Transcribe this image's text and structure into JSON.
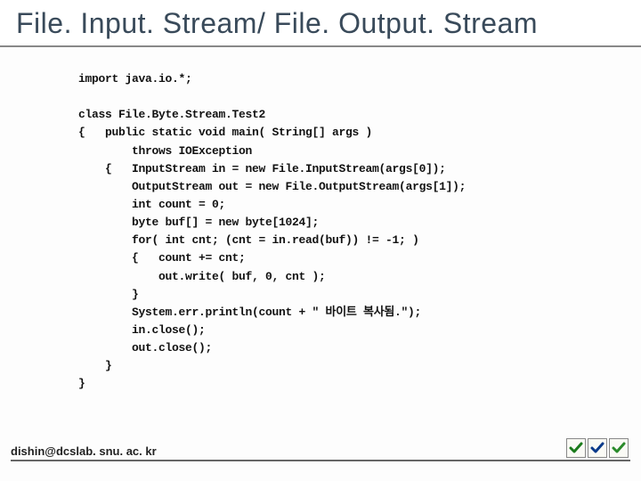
{
  "title": "File. Input. Stream/ File. Output. Stream",
  "code": "import java.io.*;\n\nclass File.Byte.Stream.Test2\n{   public static void main( String[] args )\n        throws IOException\n    {   InputStream in = new File.InputStream(args[0]);\n        OutputStream out = new File.OutputStream(args[1]);\n        int count = 0;\n        byte buf[] = new byte[1024];\n        for( int cnt; (cnt = in.read(buf)) != -1; )\n        {   count += cnt;\n            out.write( buf, 0, cnt );\n        }\n        System.err.println(count + \" 바이트 복사됨.\");\n        in.close();\n        out.close();\n    }\n}",
  "footer": {
    "email": "dishin@dcslab. snu. ac. kr"
  },
  "icons": {
    "check_green": "check-green-icon",
    "check_blue": "check-blue-icon",
    "check_green2": "check-green-icon"
  }
}
